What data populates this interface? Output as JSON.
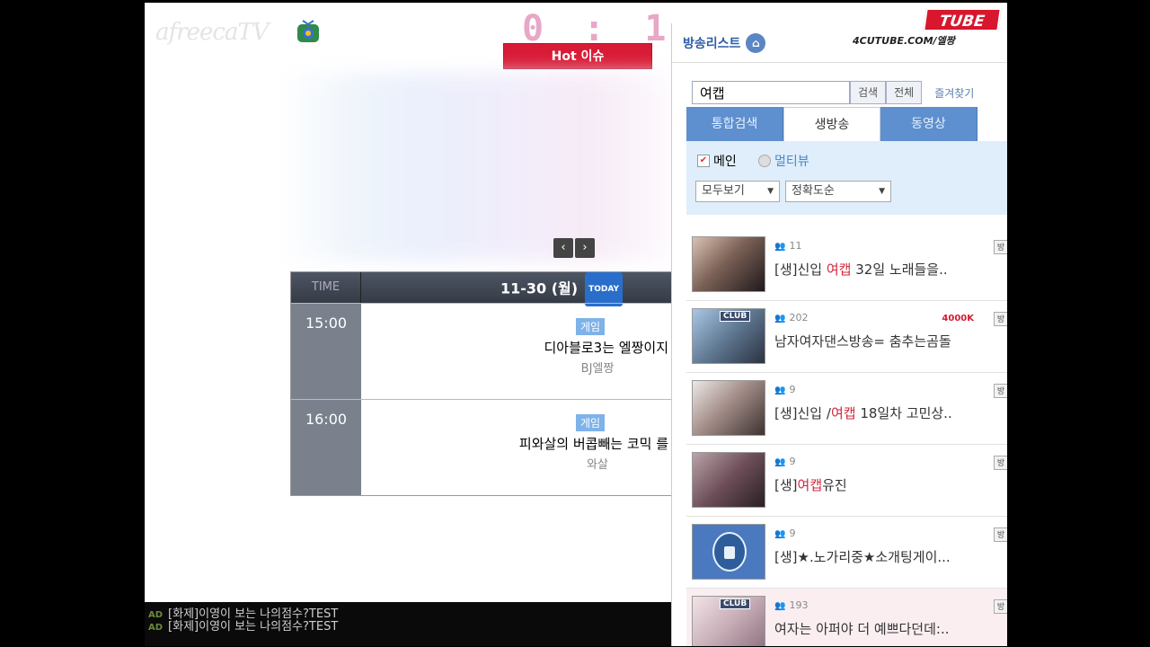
{
  "header": {
    "logo": "afreecaTV",
    "score": "0 : 1",
    "hot_label": "Hot 이슈"
  },
  "pager": {
    "prev": "‹",
    "next": "›"
  },
  "schedule": {
    "time_header": "TIME",
    "date": "11-30 (월)",
    "today_badge": "TODAY",
    "rows": [
      {
        "time": "15:00",
        "category": "게임",
        "title": "디아블로3는 엘짱이지",
        "bj": "BJ엘짱"
      },
      {
        "time": "16:00",
        "category": "게임",
        "title": "피와살의 버콥빼는 코믹 를",
        "bj": "와살"
      }
    ]
  },
  "ticker": {
    "lines": [
      {
        "tag": "AD",
        "text": "[화제]이영이 보는 나의점수?TEST"
      },
      {
        "tag": "AD",
        "text": "[화제]이영이 보는 나의점수?TEST"
      }
    ]
  },
  "panel": {
    "title": "방송리스트",
    "channel_logo": "TUBE",
    "channel_sub": "4CUTUBE.COM/엘짱",
    "search": {
      "value": "여캡",
      "search_button": "검색",
      "all_button": "전체",
      "favorites": "즐겨찾기"
    },
    "tabs": [
      "통합검색",
      "생방송",
      "동영상"
    ],
    "active_tab": "생방송",
    "options": {
      "check_main": "메인",
      "check_multiview": "멀티뷰",
      "filter": "모두보기",
      "sort": "정확도순"
    },
    "items": [
      {
        "viewers": "11",
        "prefix": "[생]신입 ",
        "highlight": "여캡",
        "suffix": " 32일 노래들을..",
        "club": "",
        "badge": "",
        "side": "방"
      },
      {
        "viewers": "202",
        "prefix": "남자여자댄스방송= 춤추는곰돌",
        "highlight": "",
        "suffix": "",
        "club": "CLUB",
        "badge": "4000K",
        "side": "방"
      },
      {
        "viewers": "9",
        "prefix": "[생]신입 /",
        "highlight": "여캡",
        "suffix": " 18일차 고민상..",
        "club": "",
        "badge": "",
        "side": "방"
      },
      {
        "viewers": "9",
        "prefix": "[생]",
        "highlight": "여캡",
        "suffix": "유진",
        "club": "",
        "badge": "",
        "side": "방"
      },
      {
        "viewers": "9",
        "prefix": "[생]★.노가리중★소개팅게이...",
        "highlight": "",
        "suffix": "",
        "club": "",
        "badge": "",
        "side": "방"
      },
      {
        "viewers": "193",
        "prefix": "여자는 아퍼야 더 예쁘다던데:..",
        "highlight": "",
        "suffix": "",
        "club": "CLUB",
        "badge": "",
        "side": "방"
      }
    ]
  }
}
